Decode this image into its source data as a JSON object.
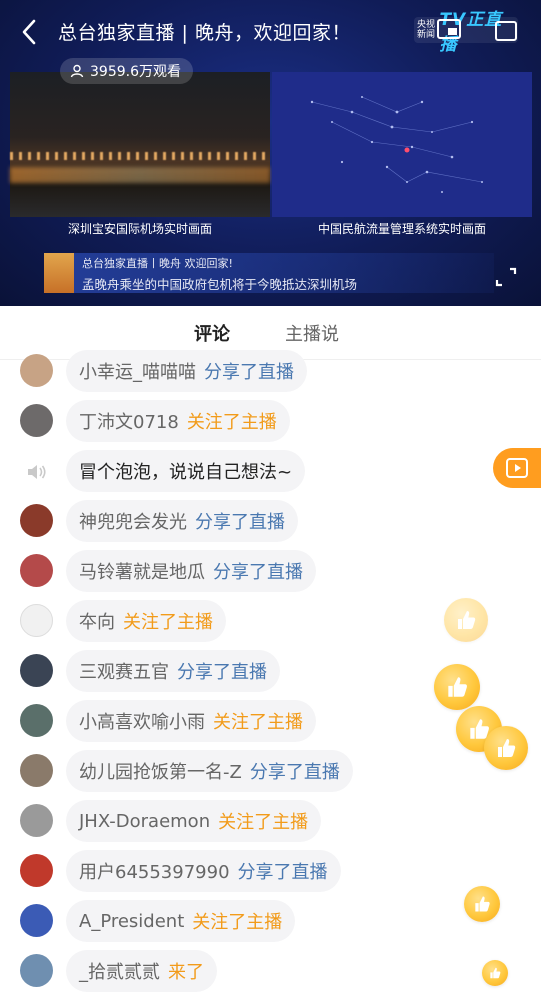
{
  "header": {
    "title": "总台独家直播 | 晚舟，欢迎回家！",
    "logo_small": "央视新闻",
    "logo_brand": "TV正直播",
    "views": "3959.6万观看",
    "feed_left_caption": "深圳宝安国际机场实时画面",
    "feed_right_caption": "中国民航流量管理系统实时画面",
    "ticker_line1": "总台独家直播丨晚舟 欢迎回家!",
    "ticker_line2": "孟晚舟乘坐的中国政府包机将于今晚抵达深圳机场"
  },
  "tabs": [
    {
      "label": "评论",
      "active": true
    },
    {
      "label": "主播说",
      "active": false
    }
  ],
  "comments": [
    {
      "name": "小幸运_喵喵喵",
      "action": "分享了直播",
      "type": "share",
      "avatar_color": "#c7a385"
    },
    {
      "name": "丁沛文0718",
      "action": "关注了主播",
      "type": "follow",
      "avatar_color": "#6d6a6a"
    },
    {
      "name": "冒个泡泡，说说自己想法~",
      "action": "",
      "type": "prompt",
      "avatar_color": ""
    },
    {
      "name": "神兜兜会发光",
      "action": "分享了直播",
      "type": "share",
      "avatar_color": "#8a3a2a"
    },
    {
      "name": "马铃薯就是地瓜",
      "action": "分享了直播",
      "type": "share",
      "avatar_color": "#b44a4a"
    },
    {
      "name": "夲向",
      "action": "关注了主播",
      "type": "follow",
      "avatar_color": "#222222"
    },
    {
      "name": "三观赛五官",
      "action": "分享了直播",
      "type": "share",
      "avatar_color": "#3a4454"
    },
    {
      "name": "小高喜欢喻小雨",
      "action": "关注了主播",
      "type": "follow",
      "avatar_color": "#5a6f6a"
    },
    {
      "name": "幼儿园抢饭第一名-Z",
      "action": "分享了直播",
      "type": "share",
      "avatar_color": "#8a7a6a"
    },
    {
      "name": "JHX-Doraemon",
      "action": "关注了主播",
      "type": "follow",
      "avatar_color": "#9a9a9a"
    },
    {
      "name": "用户6455397990",
      "action": "分享了直播",
      "type": "share",
      "avatar_color": "#c0392b"
    },
    {
      "name": "A_President",
      "action": "关注了主播",
      "type": "follow",
      "avatar_color": "#3b5bb5"
    },
    {
      "name": "_拾贰贰贰",
      "action": "来了",
      "type": "follow",
      "avatar_color": "#6f8fb0"
    }
  ],
  "colors": {
    "accent_orange": "#ff8a00",
    "share_blue": "#4a78b0",
    "follow_orange": "#f29b1a"
  }
}
